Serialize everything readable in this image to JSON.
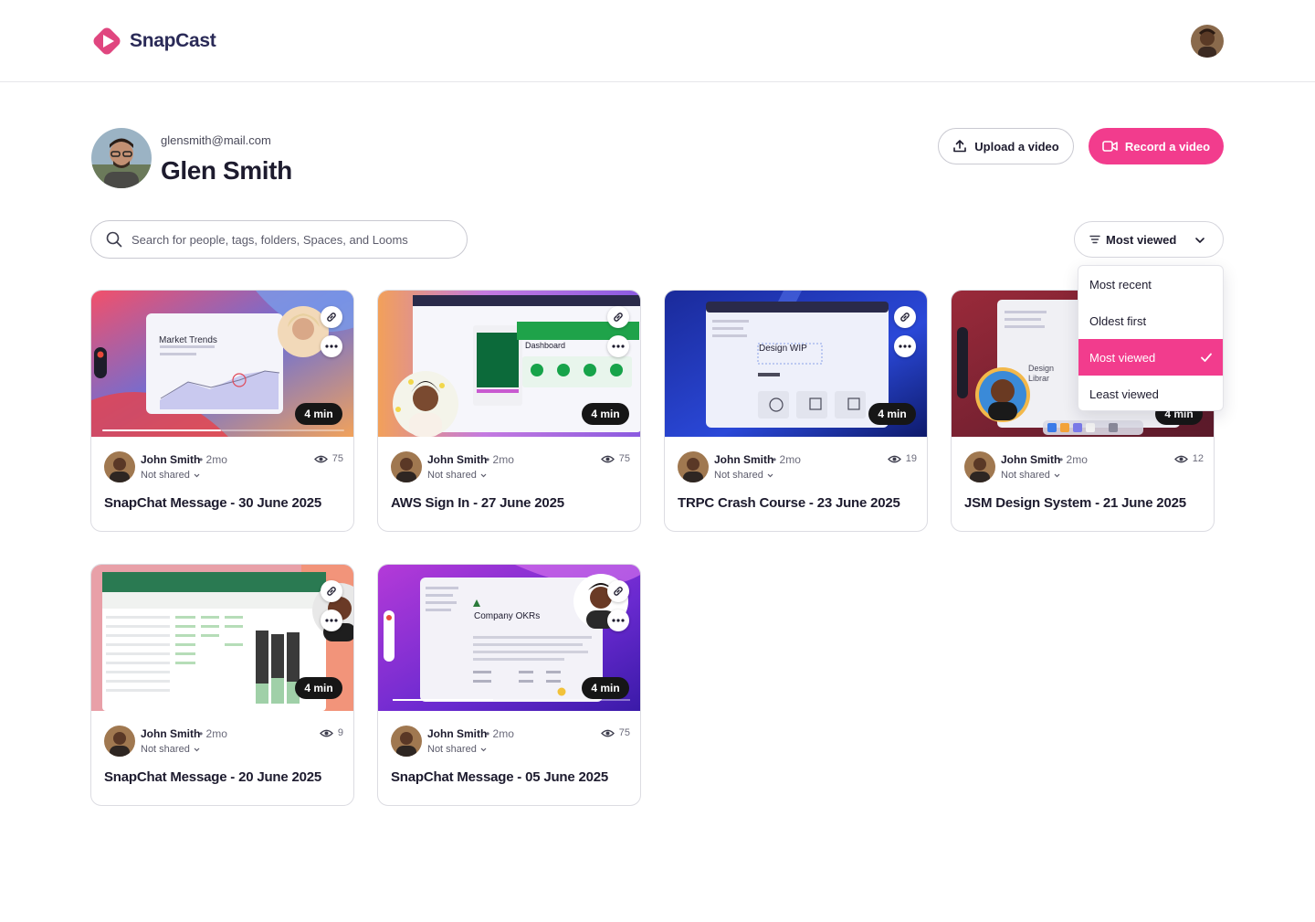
{
  "app": {
    "name": "SnapCast",
    "brand_color": "#f23c8d"
  },
  "profile": {
    "email": "glensmith@mail.com",
    "name": "Glen Smith"
  },
  "actions": {
    "upload_label": "Upload a video",
    "record_label": "Record a video"
  },
  "search": {
    "placeholder": "Search for people, tags, folders, Spaces, and Looms"
  },
  "sort": {
    "selected": "Most viewed",
    "options": [
      {
        "label": "Most recent",
        "active": false
      },
      {
        "label": "Oldest first",
        "active": false
      },
      {
        "label": "Most viewed",
        "active": true
      },
      {
        "label": "Least viewed",
        "active": false
      }
    ]
  },
  "videos": [
    {
      "title": "SnapChat Message - 30 June 2025",
      "author": "John Smith",
      "age": "• 2mo",
      "share": "Not shared",
      "views": "75",
      "duration": "4 min",
      "thumb_label": "Market Trends"
    },
    {
      "title": "AWS Sign In - 27 June 2025",
      "author": "John Smith",
      "age": "• 2mo",
      "share": "Not shared",
      "views": "75",
      "duration": "4 min",
      "thumb_label": "Dashboard"
    },
    {
      "title": "TRPC Crash Course - 23 June 2025",
      "author": "John Smith",
      "age": "• 2mo",
      "share": "Not shared",
      "views": "19",
      "duration": "4 min",
      "thumb_label": "Design WIP"
    },
    {
      "title": "JSM Design System - 21 June 2025",
      "author": "John Smith",
      "age": "• 2mo",
      "share": "Not shared",
      "views": "12",
      "duration": "4 min",
      "thumb_label": "Design Librar"
    },
    {
      "title": "SnapChat Message - 20 June 2025",
      "author": "John Smith",
      "age": "• 2mo",
      "share": "Not shared",
      "views": "9",
      "duration": "4 min",
      "thumb_label": ""
    },
    {
      "title": "SnapChat Message - 05 June 2025",
      "author": "John Smith",
      "age": "• 2mo",
      "share": "Not shared",
      "views": "75",
      "duration": "4 min",
      "thumb_label": "Company OKRs"
    }
  ]
}
